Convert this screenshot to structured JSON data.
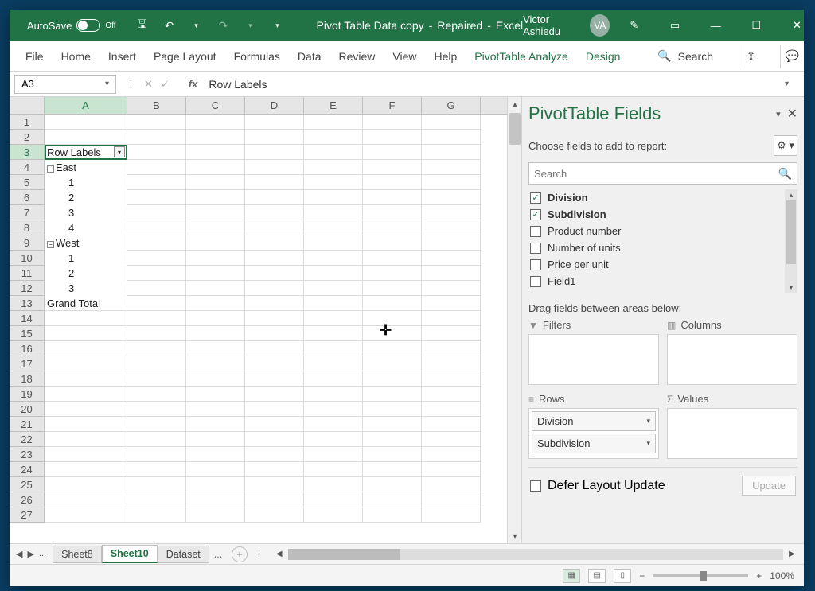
{
  "titlebar": {
    "autosave_label": "AutoSave",
    "autosave_state": "Off",
    "doc_name": "Pivot Table Data copy",
    "doc_status": "Repaired",
    "app_name": "Excel",
    "user_name": "Victor Ashiedu",
    "user_initials": "VA"
  },
  "ribbon": {
    "tabs": [
      "File",
      "Home",
      "Insert",
      "Page Layout",
      "Formulas",
      "Data",
      "Review",
      "View",
      "Help"
    ],
    "contextual": [
      "PivotTable Analyze",
      "Design"
    ],
    "search_label": "Search"
  },
  "formula_bar": {
    "name_box": "A3",
    "formula": "Row Labels"
  },
  "grid": {
    "columns": [
      "A",
      "B",
      "C",
      "D",
      "E",
      "F",
      "G"
    ],
    "row_numbers": [
      "1",
      "2",
      "3",
      "4",
      "5",
      "6",
      "7",
      "8",
      "9",
      "10",
      "11",
      "12",
      "13",
      "14",
      "15",
      "16",
      "17",
      "18",
      "19",
      "20",
      "21",
      "22",
      "23",
      "24",
      "25",
      "26",
      "27"
    ],
    "cells": {
      "A3": "Row Labels",
      "A4": "East",
      "A5": "1",
      "A6": "2",
      "A7": "3",
      "A8": "4",
      "A9": "West",
      "A10": "1",
      "A11": "2",
      "A12": "3",
      "A13": "Grand Total"
    }
  },
  "pivot_pane": {
    "title": "PivotTable Fields",
    "subtitle": "Choose fields to add to report:",
    "search_placeholder": "Search",
    "fields": [
      {
        "label": "Division",
        "checked": true
      },
      {
        "label": "Subdivision",
        "checked": true
      },
      {
        "label": "Product number",
        "checked": false
      },
      {
        "label": "Number of units",
        "checked": false
      },
      {
        "label": "Price per unit",
        "checked": false
      },
      {
        "label": "Field1",
        "checked": false
      }
    ],
    "drag_hint": "Drag fields between areas below:",
    "areas": {
      "filters": {
        "label": "Filters",
        "items": []
      },
      "columns": {
        "label": "Columns",
        "items": []
      },
      "rows": {
        "label": "Rows",
        "items": [
          "Division",
          "Subdivision"
        ]
      },
      "values": {
        "label": "Values",
        "items": []
      }
    },
    "defer_label": "Defer Layout Update",
    "update_label": "Update"
  },
  "sheets": {
    "tabs": [
      "Sheet8",
      "Sheet10",
      "Dataset"
    ],
    "active": "Sheet10",
    "ellipsis": "...",
    "more": "..."
  },
  "status": {
    "zoom": "100%"
  }
}
